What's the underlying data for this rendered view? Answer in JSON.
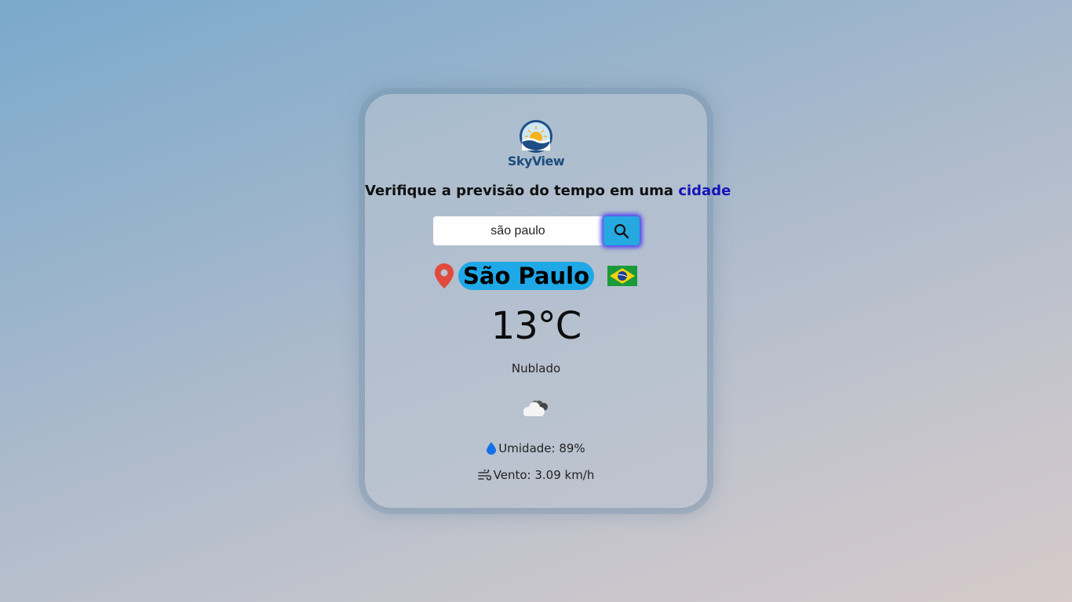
{
  "brand": {
    "name": "SkyView"
  },
  "headline": {
    "prefix": "Verifique a previsão do tempo em uma ",
    "accent": "cidade"
  },
  "search": {
    "value": "são paulo",
    "button_icon": "search-icon"
  },
  "location": {
    "city": "São Paulo",
    "pin_icon": "map-pin-icon",
    "country_flag": "brazil-flag"
  },
  "weather": {
    "temperature": "13°C",
    "description": "Nublado",
    "icon": "cloudy-icon",
    "humidity_label": "Umidade: 89%",
    "wind_label": "Vento: 3.09 km/h"
  },
  "colors": {
    "accent": "#1414b8",
    "button": "#26a9e0",
    "city_badge": "#1ea8e6"
  }
}
